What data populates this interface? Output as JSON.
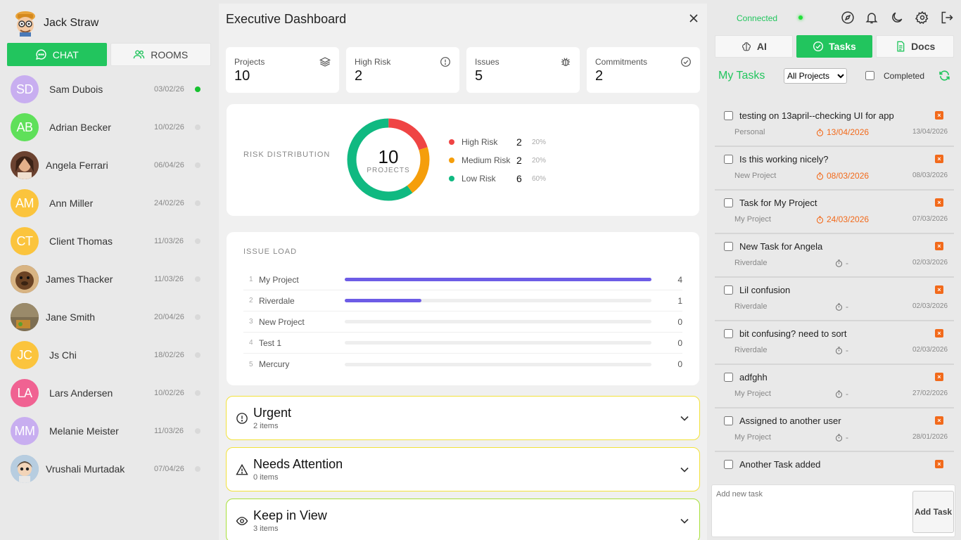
{
  "user": {
    "name": "Jack Straw"
  },
  "chat_tabs": {
    "chat": "CHAT",
    "rooms": "ROOMS"
  },
  "contacts": [
    {
      "initials": "SD",
      "name": "Sam Dubois",
      "date": "03/02/26",
      "color": "#c8aef0",
      "online": true
    },
    {
      "initials": "AB",
      "name": "Adrian Becker",
      "date": "10/02/26",
      "color": "#5fe05a",
      "online": false
    },
    {
      "initials": "",
      "name": "Angela Ferrari",
      "date": "06/04/26",
      "color": "#8a5a3a",
      "online": false
    },
    {
      "initials": "AM",
      "name": "Ann Miller",
      "date": "24/02/26",
      "color": "#fbc43d",
      "online": false
    },
    {
      "initials": "CT",
      "name": "Client Thomas",
      "date": "11/03/26",
      "color": "#fbc43d",
      "online": false
    },
    {
      "initials": "",
      "name": "James Thacker",
      "date": "11/03/26",
      "color": "#6b4a2a",
      "online": false
    },
    {
      "initials": "",
      "name": "Jane Smith",
      "date": "20/04/26",
      "color": "#8b7d5e",
      "online": false
    },
    {
      "initials": "JC",
      "name": "Js Chi",
      "date": "18/02/26",
      "color": "#fbc43d",
      "online": false
    },
    {
      "initials": "LA",
      "name": "Lars Andersen",
      "date": "10/02/26",
      "color": "#f06292",
      "online": false
    },
    {
      "initials": "MM",
      "name": "Melanie Meister",
      "date": "11/03/26",
      "color": "#c8aef0",
      "online": false
    },
    {
      "initials": "",
      "name": "Vrushali Murtadak",
      "date": "07/04/26",
      "color": "#9ab0c8",
      "online": false
    }
  ],
  "dashboard": {
    "title": "Executive Dashboard",
    "stats": [
      {
        "label": "Projects",
        "value": "10",
        "icon": "layers-icon"
      },
      {
        "label": "High Risk",
        "value": "2",
        "icon": "alert-circle-icon"
      },
      {
        "label": "Issues",
        "value": "5",
        "icon": "bug-icon"
      },
      {
        "label": "Commitments",
        "value": "2",
        "icon": "check-circle-icon"
      }
    ],
    "risk": {
      "title": "RISK DISTRIBUTION",
      "total": "10",
      "total_label": "PROJECTS",
      "items": [
        {
          "label": "High Risk",
          "value": 2,
          "pct": "20%",
          "color": "#ef4444"
        },
        {
          "label": "Medium Risk",
          "value": 2,
          "pct": "20%",
          "color": "#f59e0b"
        },
        {
          "label": "Low Risk",
          "value": 6,
          "pct": "60%",
          "color": "#10b981"
        }
      ]
    },
    "issue_load": {
      "title": "ISSUE LOAD",
      "max": 4,
      "rows": [
        {
          "n": "1",
          "project": "My Project",
          "value": 4
        },
        {
          "n": "2",
          "project": "Riverdale",
          "value": 1
        },
        {
          "n": "3",
          "project": "New Project",
          "value": 0
        },
        {
          "n": "4",
          "project": "Test 1",
          "value": 0
        },
        {
          "n": "5",
          "project": "Mercury",
          "value": 0
        }
      ]
    },
    "sections": [
      {
        "title": "Urgent",
        "count": "2 items",
        "icon": "alert-circle-icon",
        "border": "#f2e23b"
      },
      {
        "title": "Needs Attention",
        "count": "0 items",
        "icon": "warning-triangle-icon",
        "border": "#f2e23b"
      },
      {
        "title": "Keep in View",
        "count": "3 items",
        "icon": "eye-icon",
        "border": "#a8e03a"
      }
    ]
  },
  "right": {
    "status": "Connected",
    "tabs": {
      "ai": "AI",
      "tasks": "Tasks",
      "docs": "Docs"
    },
    "my_tasks": "My Tasks",
    "project_filter": "All Projects",
    "completed_label": "Completed",
    "add_placeholder": "Add new task",
    "add_button": "Add Task",
    "tasks": [
      {
        "name": "testing on 13april--checking UI for app",
        "project": "Personal",
        "due": "13/04/2026",
        "overdue": true,
        "created": "13/04/2026"
      },
      {
        "name": "Is this working nicely?",
        "project": "New Project",
        "due": "08/03/2026",
        "overdue": true,
        "created": "08/03/2026"
      },
      {
        "name": "Task for My Project",
        "project": "My Project",
        "due": "24/03/2026",
        "overdue": true,
        "created": "07/03/2026"
      },
      {
        "name": "New Task for Angela",
        "project": "Riverdale",
        "due": "-",
        "overdue": false,
        "created": "02/03/2026"
      },
      {
        "name": "Lil confusion",
        "project": "Riverdale",
        "due": "-",
        "overdue": false,
        "created": "02/03/2026"
      },
      {
        "name": "bit confusing? need to sort",
        "project": "Riverdale",
        "due": "-",
        "overdue": false,
        "created": "02/03/2026"
      },
      {
        "name": "adfghh",
        "project": "My Project",
        "due": "-",
        "overdue": false,
        "created": "27/02/2026"
      },
      {
        "name": "Assigned to another user",
        "project": "My Project",
        "due": "-",
        "overdue": false,
        "created": "28/01/2026"
      },
      {
        "name": "Another Task added",
        "project": "",
        "due": "",
        "overdue": false,
        "created": ""
      }
    ]
  }
}
